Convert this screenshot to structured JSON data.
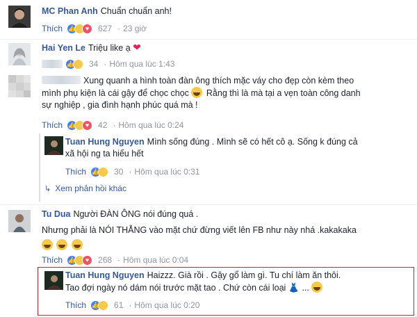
{
  "comments": [
    {
      "name": "MC Phan Anh",
      "lines": [
        "Chuẩn chuẩn anh!"
      ],
      "meta": {
        "like": "Thích",
        "reaction_count": "627",
        "time": "23 giờ"
      }
    },
    {
      "name": "Hai Yen Le",
      "lines": [
        "Triệu like ạ"
      ],
      "emoji": "heart",
      "meta": {
        "reaction_count": "34",
        "time": "Hôm qua lúc 1:43"
      }
    },
    {
      "name": "",
      "lines": [
        "Xung quanh a hình toàn đàn ông thích mặc váy cho đẹp còn kèm theo",
        "mình phụ kiện là cái gậy để chọc chọc",
        "Rằng thì là mà tại a vẹn toàn công danh",
        "sự nghiệp , gia đình hạnh phúc quá mà !"
      ],
      "meta": {
        "like": "Thích",
        "reaction_count": "42",
        "time": "Hôm qua lúc 0:24"
      }
    },
    {
      "name": "Tuan Hung Nguyen",
      "lines": [
        "Mình sống đúng . Mình sẽ có hết cô ạ. Sống k đúng cả",
        "xã hội ng ta hiểu hết"
      ],
      "meta": {
        "like": "Thích",
        "reaction_count": "30",
        "time": "Hôm qua lúc 0:31"
      }
    },
    {
      "name": "Tu Dua",
      "lines": [
        "Người ĐÀN ÔNG nói đúng quá .",
        "Nhưng phải là NÓI THẲNG vào mặt chứ đừng viết lên FB như này nhá .kakakaka"
      ],
      "meta": {
        "like": "Thích",
        "reaction_count": "268",
        "time": "Hôm qua lúc 0:04"
      }
    },
    {
      "name": "Tuan Hung Nguyen",
      "lines": [
        "Haizzz. Già rồi . Gậy gổ làm gì. Tu chí làm ăn thôi.",
        "Tao đợi ngày nó dám nói trước mặt tao . Chứ còn cái loại",
        "..."
      ],
      "meta": {
        "like": "Thích",
        "reaction_count": "61",
        "time": "Hôm qua lúc 0:20"
      }
    }
  ],
  "more_replies": "Xem phản hồi khác",
  "icons": {
    "reaction_like": "thumbs-up-icon",
    "reaction_haha": "laughing-face-icon",
    "reaction_love": "heart-icon",
    "emoji_laugh": "tears-of-joy-emoji-icon",
    "emoji_dress": "dress-icon",
    "emoji_smirk": "smirk-emoji-icon"
  },
  "colors": {
    "name": "#365899",
    "meta": "#90949c",
    "text": "#1d2129",
    "highlight": "#c0262d"
  }
}
